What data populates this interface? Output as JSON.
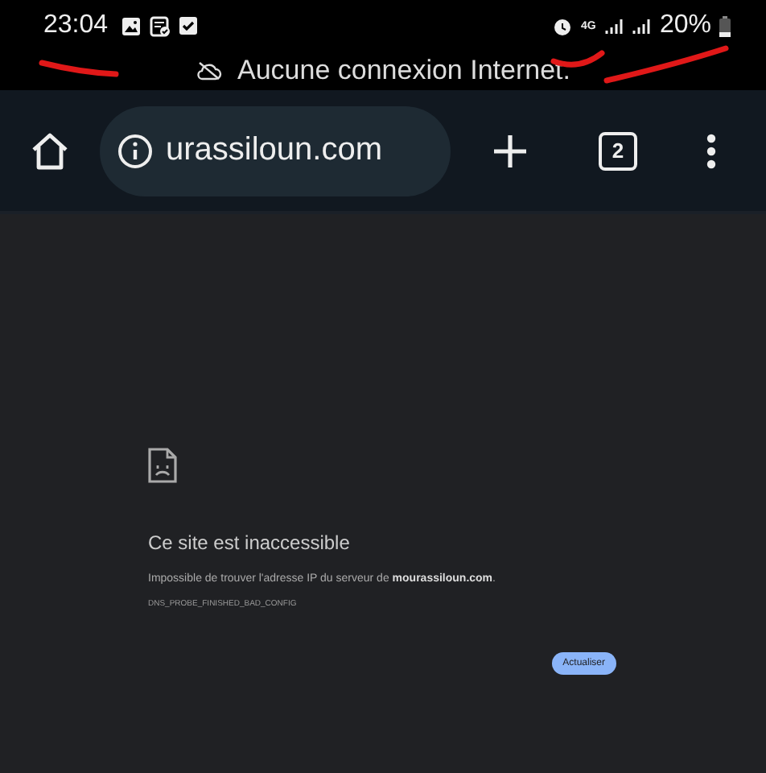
{
  "status_bar": {
    "time": "23:04",
    "network_type": "4G",
    "battery": "20%"
  },
  "notice": {
    "text": "Aucune connexion Internet."
  },
  "toolbar": {
    "url": "urassiloun.com",
    "tab_count": "2"
  },
  "error_page": {
    "title": "Ce site est inaccessible",
    "message": "Impossible de trouver l'adresse IP du serveur de **mourassiloun.com**.",
    "code": "DNS_PROBE_FINISHED_BAD_CONFIG",
    "button": "Actualiser"
  }
}
